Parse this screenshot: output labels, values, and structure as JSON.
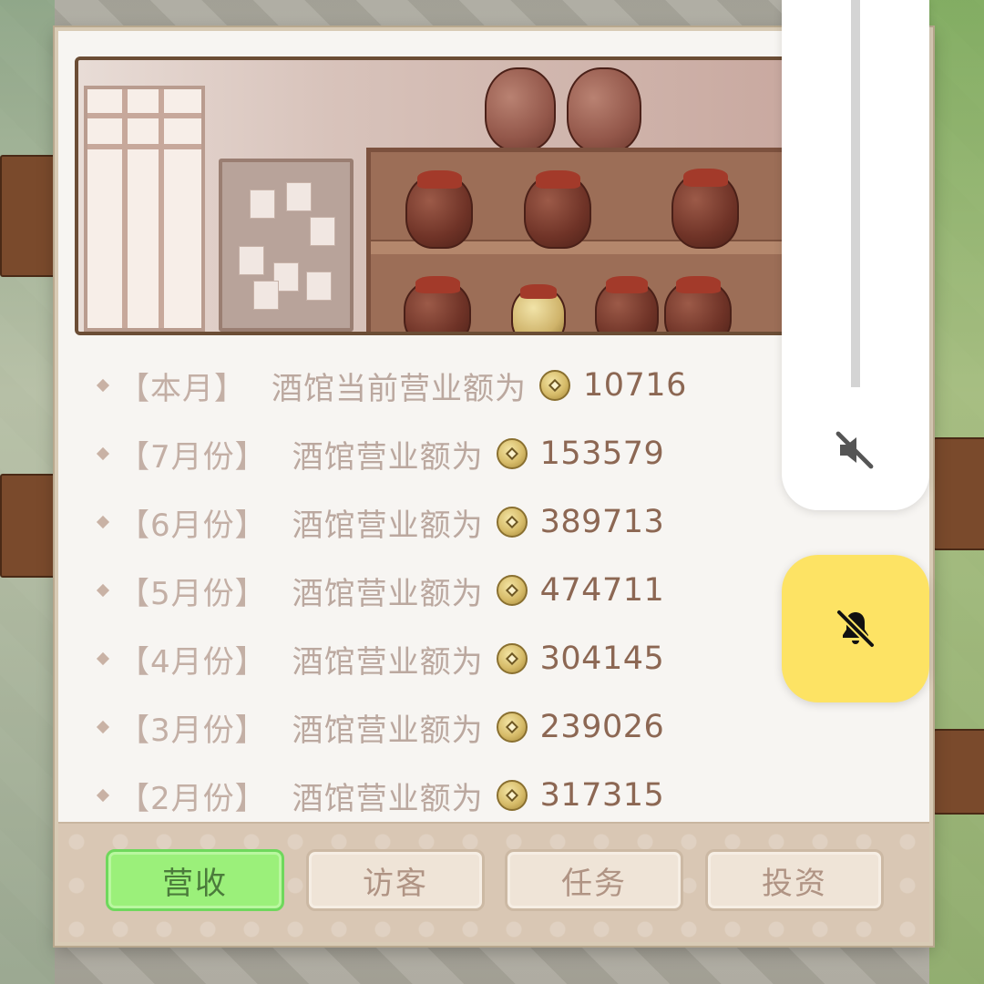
{
  "revenue_rows": [
    {
      "label": "【本月】",
      "text": "酒馆当前营业额为",
      "value": "10716"
    },
    {
      "label": "【7月份】",
      "text": "酒馆营业额为",
      "value": "153579"
    },
    {
      "label": "【6月份】",
      "text": "酒馆营业额为",
      "value": "389713"
    },
    {
      "label": "【5月份】",
      "text": "酒馆营业额为",
      "value": "474711"
    },
    {
      "label": "【4月份】",
      "text": "酒馆营业额为",
      "value": "304145"
    },
    {
      "label": "【3月份】",
      "text": "酒馆营业额为",
      "value": "239026"
    },
    {
      "label": "【2月份】",
      "text": "酒馆营业额为",
      "value": "317315"
    }
  ],
  "tabs": [
    {
      "label": "营收",
      "active": true
    },
    {
      "label": "访客",
      "active": false
    },
    {
      "label": "任务",
      "active": false
    },
    {
      "label": "投资",
      "active": false
    }
  ],
  "overlay": {
    "volume_icon": "volume-muted-icon",
    "bell_icon": "bell-off-icon"
  },
  "colors": {
    "active_tab": "#9bf07a",
    "bell_button": "#fde364",
    "value_text": "#8c6753"
  }
}
